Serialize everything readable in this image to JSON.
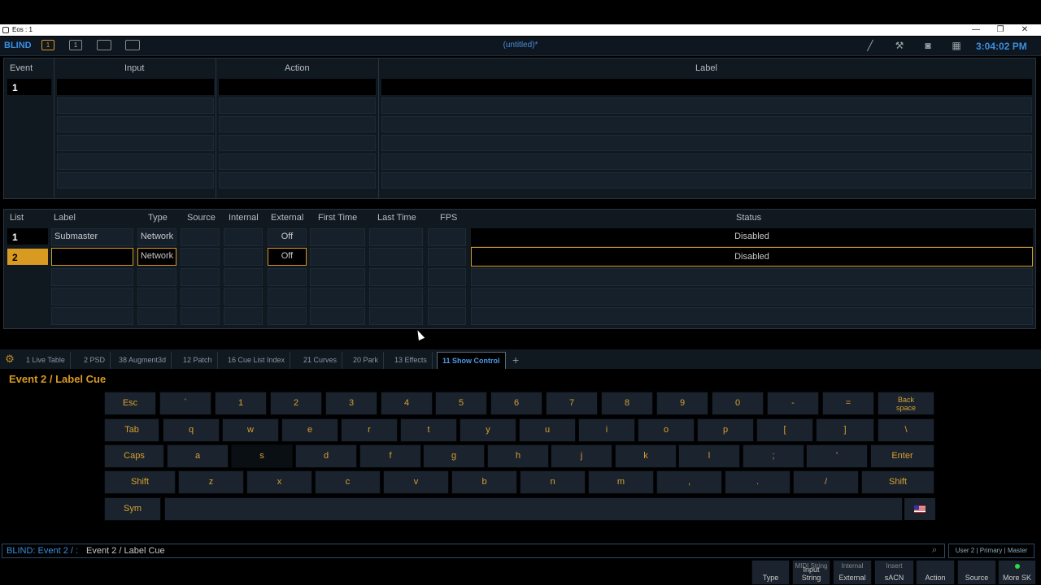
{
  "window": {
    "title": "Eos : 1",
    "minimize": "—",
    "restore": "❐",
    "close": "✕"
  },
  "header": {
    "mode": "BLIND",
    "icon1": "1",
    "icon2": "1",
    "document": "(untitled)*",
    "time": "3:04:02 PM"
  },
  "event_table": {
    "columns": [
      "Event",
      "Input",
      "Action",
      "Label"
    ],
    "rows": [
      {
        "event": "1",
        "input": "",
        "action": "",
        "label": ""
      }
    ]
  },
  "list_table": {
    "columns": [
      "List",
      "Label",
      "Type",
      "Source",
      "Internal",
      "External",
      "First Time",
      "Last Time",
      "FPS",
      "Status"
    ],
    "rows": [
      {
        "list": "1",
        "label": "Submaster",
        "type": "Network",
        "source": "",
        "internal": "",
        "external": "Off",
        "first": "",
        "last": "",
        "fps": "",
        "status": "Disabled"
      },
      {
        "list": "2",
        "label": "",
        "type": "Network",
        "source": "",
        "internal": "",
        "external": "Off",
        "first": "",
        "last": "",
        "fps": "",
        "status": "Disabled"
      }
    ]
  },
  "tabs": [
    {
      "label": "1 Live Table"
    },
    {
      "label": "2 PSD"
    },
    {
      "label": "38 Augment3d"
    },
    {
      "label": "12 Patch"
    },
    {
      "label": "16 Cue List Index"
    },
    {
      "label": "21 Curves"
    },
    {
      "label": "20 Park"
    },
    {
      "label": "13 Effects"
    },
    {
      "label": "11 Show Control"
    }
  ],
  "tab_add": "+",
  "keyboard": {
    "title": "Event 2 / Label Cue",
    "row1": [
      "Esc",
      "`",
      "1",
      "2",
      "3",
      "4",
      "5",
      "6",
      "7",
      "8",
      "9",
      "0",
      "-",
      "="
    ],
    "backspace": [
      "Back",
      "space"
    ],
    "row2": [
      "Tab",
      "q",
      "w",
      "e",
      "r",
      "t",
      "y",
      "u",
      "i",
      "o",
      "p",
      "[",
      "]",
      "\\"
    ],
    "row3": [
      "Caps",
      "a",
      "s",
      "d",
      "f",
      "g",
      "h",
      "j",
      "k",
      "l",
      ";",
      "'",
      "Enter"
    ],
    "row4": [
      "Shift",
      "z",
      "x",
      "c",
      "v",
      "b",
      "n",
      "m",
      ",",
      ".",
      "/",
      "Shift"
    ],
    "sym": "Sym"
  },
  "command_line": {
    "prefix": "BLIND: Event  2 / :",
    "text": "Event 2 / Label Cue"
  },
  "user": "User 2 | Primary | Master",
  "softkeys": [
    {
      "top": "",
      "label": "Type"
    },
    {
      "top": "MIDI String",
      "label": "Input String"
    },
    {
      "top": "Internal",
      "label": "External"
    },
    {
      "top": "Insert",
      "label": "sACN"
    },
    {
      "top": "",
      "label": "Action"
    },
    {
      "top": "",
      "label": "Source"
    },
    {
      "top": "",
      "label": "More SK"
    }
  ],
  "colors": {
    "accent": "#d89a20",
    "blue": "#3a8fe0",
    "softkey_indicator": "#2fd84a"
  }
}
